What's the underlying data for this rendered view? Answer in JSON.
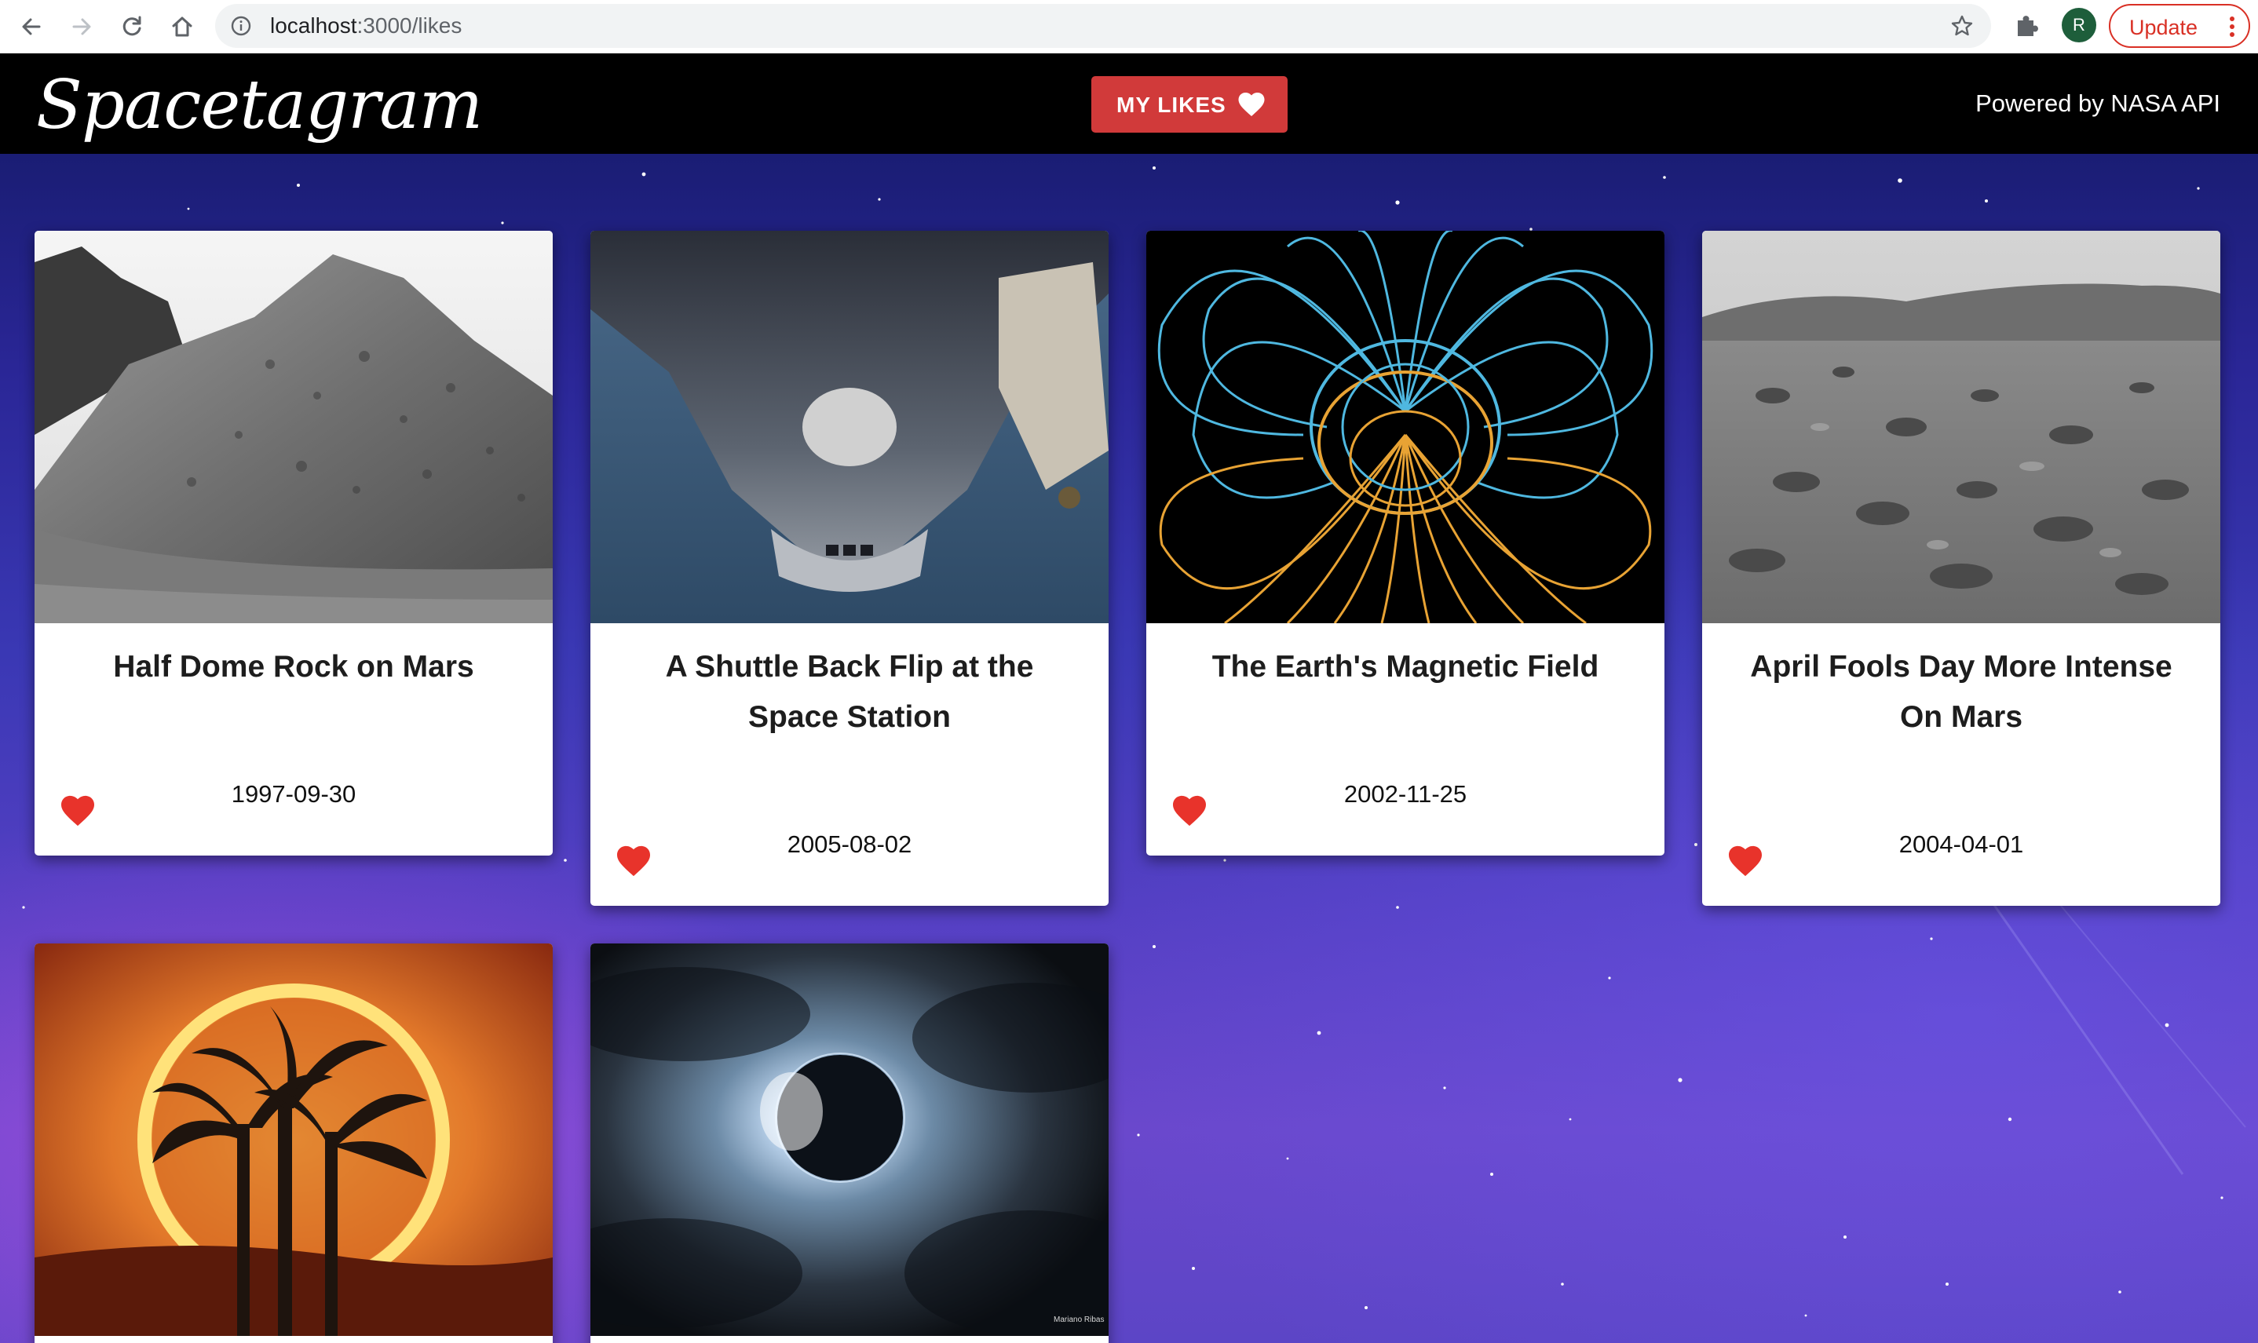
{
  "browser": {
    "url_host": "localhost",
    "url_path": ":3000/likes",
    "avatar_initial": "R",
    "update_label": "Update"
  },
  "header": {
    "logo": "Spacetagram",
    "my_likes_label": "MY LIKES",
    "powered_by": "Powered by NASA API"
  },
  "cards": [
    {
      "title": "Half Dome Rock on Mars",
      "date": "1997-09-30",
      "liked": true
    },
    {
      "title": "A Shuttle Back Flip at the Space Station",
      "date": "2005-08-02",
      "liked": true
    },
    {
      "title": "The Earth's Magnetic Field",
      "date": "2002-11-25",
      "liked": true
    },
    {
      "title": "April Fools Day More Intense On Mars",
      "date": "2004-04-01",
      "liked": true
    },
    {
      "title": "",
      "date": "",
      "liked": true
    },
    {
      "title": "",
      "date": "",
      "liked": true
    }
  ],
  "photo_credit": "Mariano Ribas",
  "colors": {
    "heart_red": "#e8332b",
    "button_red": "#d13a3a",
    "header_black": "#000000"
  }
}
